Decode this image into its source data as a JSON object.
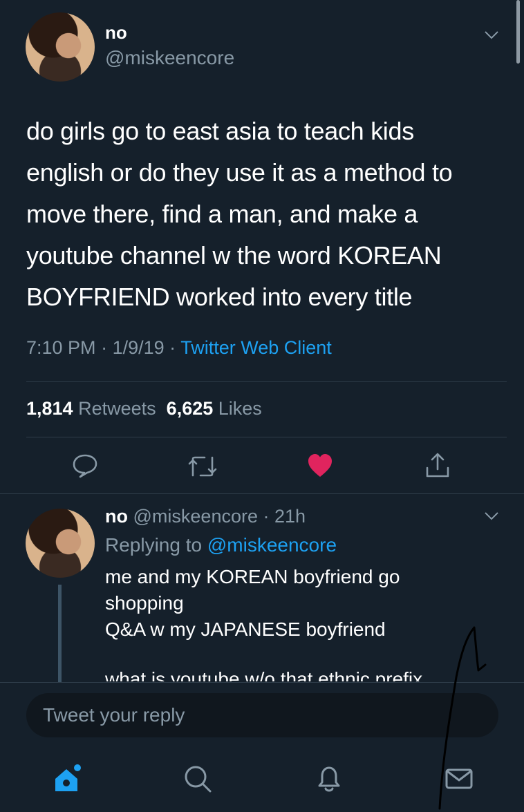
{
  "tweet": {
    "display_name": "no",
    "handle": "@miskeencore",
    "text_lines": [
      "do girls go to east asia to teach kids",
      "english or do they use it as a method to",
      "move there, find a man, and make a",
      "youtube channel w the word KOREAN",
      "BOYFRIEND worked into every title"
    ],
    "time": "7:10 PM",
    "date": "1/9/19",
    "client": "Twitter Web Client",
    "retweets_count": "1,814",
    "retweets_label": "Retweets",
    "likes_count": "6,625",
    "likes_label": "Likes"
  },
  "reply": {
    "display_name": "no",
    "handle": "@miskeencore",
    "age": "21h",
    "replying_to_label": "Replying to",
    "replying_to_handle": "@miskeencore",
    "lines": [
      "me and my KOREAN boyfriend go",
      "shopping",
      "Q&A w my JAPANESE boyfriend"
    ],
    "cut_line": "what is youtube w/o that ethnic prefix"
  },
  "composer": {
    "placeholder": "Tweet your reply"
  },
  "colors": {
    "background": "#15202b",
    "accent": "#1da1f2",
    "like": "#e0245e",
    "muted": "#8899a6"
  },
  "icons": {
    "actions": [
      "reply-icon",
      "retweet-icon",
      "heart-icon",
      "share-icon"
    ],
    "nav": [
      "home-icon",
      "search-icon",
      "notifications-icon",
      "messages-icon"
    ]
  }
}
